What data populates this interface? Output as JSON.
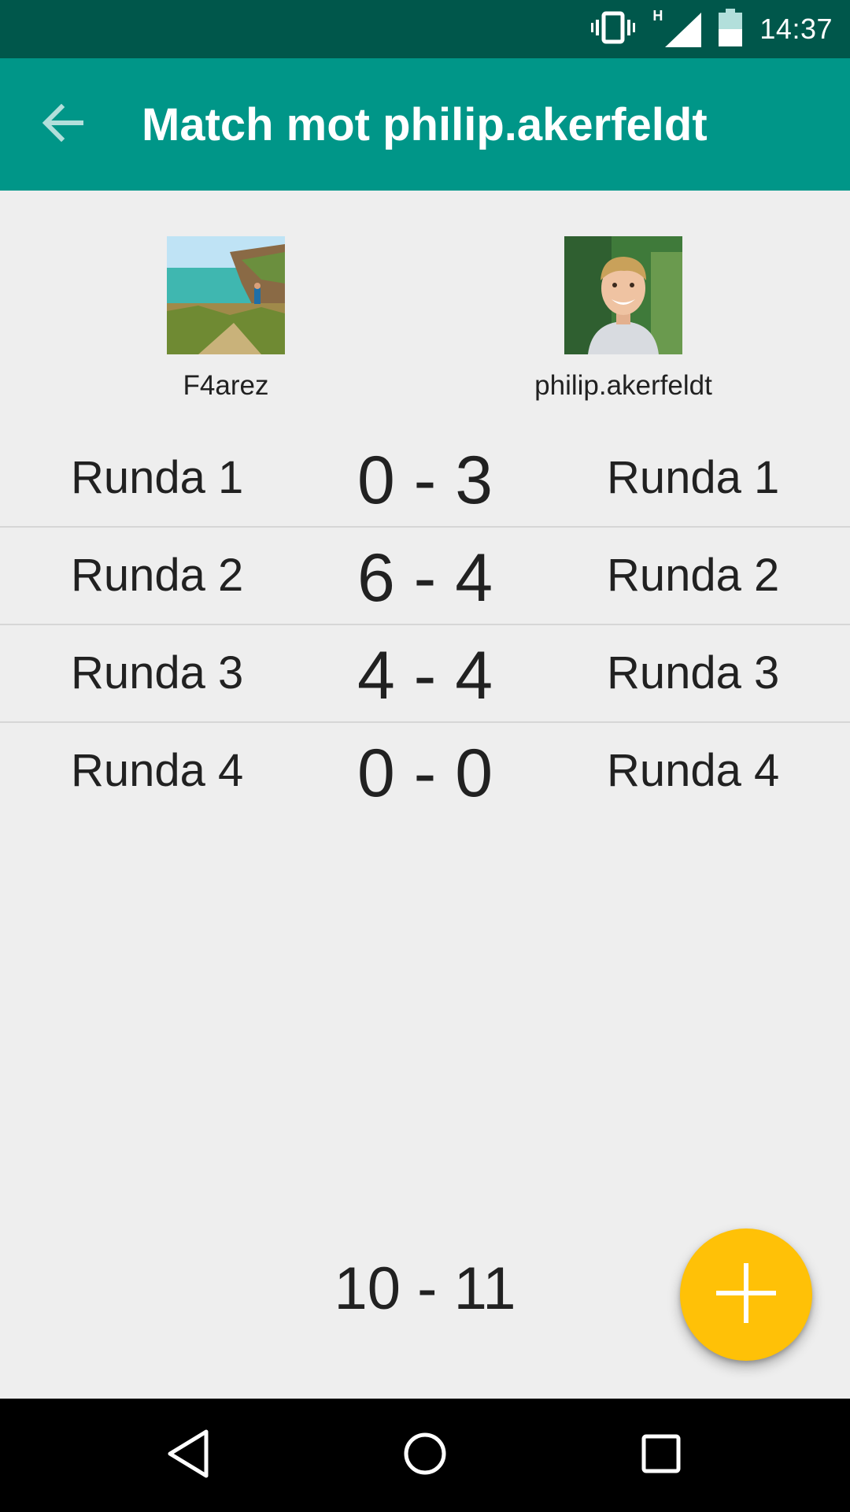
{
  "status_bar": {
    "time": "14:37",
    "network_type": "H",
    "icons": [
      "vibrate-icon",
      "signal-icon",
      "battery-icon"
    ]
  },
  "app_bar": {
    "title": "Match mot philip.akerfeldt",
    "back_icon": "arrow-back-icon"
  },
  "players": [
    {
      "name": "F4arez",
      "avatar": "landscape-photo-avatar"
    },
    {
      "name": "philip.akerfeldt",
      "avatar": "portrait-photo-avatar"
    }
  ],
  "rounds": [
    {
      "left_label": "Runda 1",
      "score": "0 - 3",
      "right_label": "Runda 1"
    },
    {
      "left_label": "Runda 2",
      "score": "6 - 4",
      "right_label": "Runda 2"
    },
    {
      "left_label": "Runda 3",
      "score": "4 - 4",
      "right_label": "Runda 3"
    },
    {
      "left_label": "Runda 4",
      "score": "0 - 0",
      "right_label": "Runda 4"
    }
  ],
  "total_score": "10 - 11",
  "fab": {
    "icon": "plus-icon"
  },
  "nav_bar": {
    "buttons": [
      "back-triangle-icon",
      "home-circle-icon",
      "recents-square-icon"
    ]
  },
  "colors": {
    "status_bar": "#00574b",
    "app_bar": "#009688",
    "background": "#eeeeee",
    "fab": "#ffc107",
    "text": "#212121"
  }
}
